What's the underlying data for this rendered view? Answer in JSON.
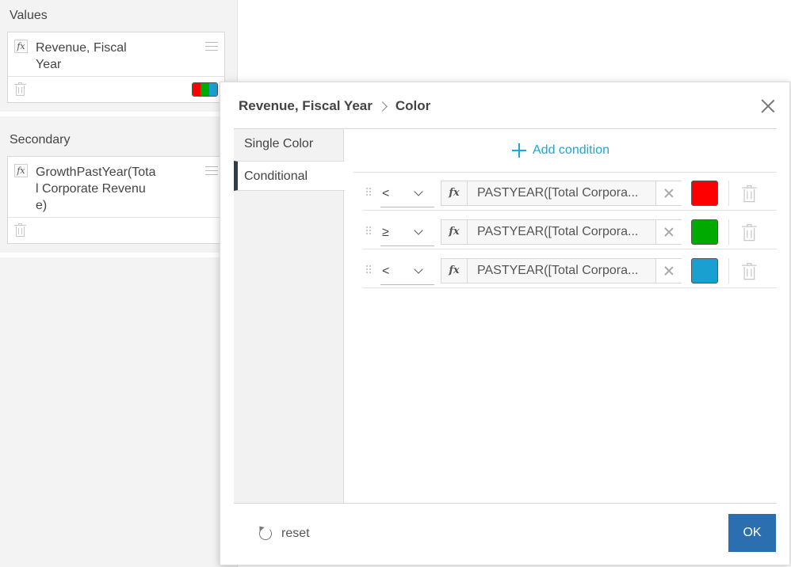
{
  "left_panel": {
    "values_section": {
      "title": "Values",
      "field_name": "Revenue, Fiscal Year",
      "fx_label": "fx",
      "color_swatch": [
        "#ff0000",
        "#00aa00",
        "#1a9fd1"
      ]
    },
    "secondary_section": {
      "title": "Secondary",
      "field_name": "GrowthPastYear(Total Corporate Revenue)",
      "fx_label": "fx"
    }
  },
  "dialog": {
    "breadcrumb": [
      "Revenue, Fiscal Year",
      "Color"
    ],
    "tabs": [
      {
        "label": "Single Color",
        "active": false
      },
      {
        "label": "Conditional",
        "active": true
      }
    ],
    "add_condition_label": "Add condition",
    "conditions": [
      {
        "operator": "<",
        "fx_label": "fx",
        "expression": "PASTYEAR([Total Corpora...",
        "color": "#ff0000"
      },
      {
        "operator": "≥",
        "fx_label": "fx",
        "expression": "PASTYEAR([Total Corpora...",
        "color": "#00aa00"
      },
      {
        "operator": "<",
        "fx_label": "fx",
        "expression": "PASTYEAR([Total Corpora...",
        "color": "#1a9fd1"
      }
    ],
    "reset_label": "reset",
    "ok_label": "OK"
  },
  "colors": {
    "accent": "#1ea7d6",
    "ok_button": "#2c6fb0",
    "active_tab_marker": "#2f3c4a"
  }
}
